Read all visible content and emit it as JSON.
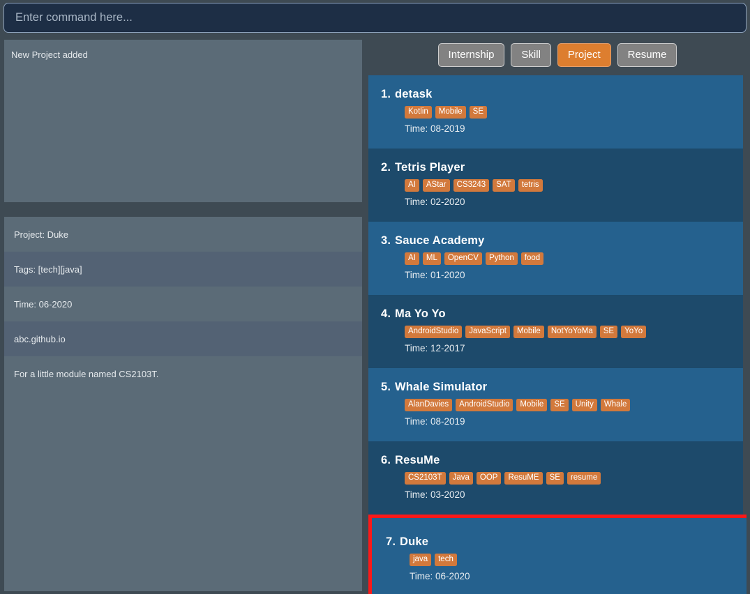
{
  "command": {
    "placeholder": "Enter command here...",
    "value": ""
  },
  "result": {
    "message": "New Project added"
  },
  "detail": {
    "rows": [
      {
        "text": "Project: Duke"
      },
      {
        "text": "Tags: [tech][java]"
      },
      {
        "text": "Time: 06-2020"
      },
      {
        "text": "abc.github.io"
      },
      {
        "text": "For a little module named CS2103T."
      }
    ]
  },
  "tabs": [
    {
      "label": "Internship",
      "active": false
    },
    {
      "label": "Skill",
      "active": false
    },
    {
      "label": "Project",
      "active": true
    },
    {
      "label": "Resume",
      "active": false
    }
  ],
  "colors": {
    "accent": "#DD7E2F",
    "tag": "#D2793C",
    "row_light": "#25618E",
    "row_dark": "#1D4A6B",
    "selection_outline": "#FA1919",
    "panel": "#5B6B77",
    "panel_alt": "#536274",
    "app_background": "#3E4A53",
    "command_background": "#1D2E45"
  },
  "list": {
    "items": [
      {
        "index": "1.",
        "title": "detask",
        "tags": [
          "Kotlin",
          "Mobile",
          "SE"
        ],
        "time": "Time: 08-2019",
        "selected": false
      },
      {
        "index": "2.",
        "title": "Tetris Player",
        "tags": [
          "AI",
          "AStar",
          "CS3243",
          "SAT",
          "tetris"
        ],
        "time": "Time: 02-2020",
        "selected": false
      },
      {
        "index": "3.",
        "title": "Sauce Academy",
        "tags": [
          "AI",
          "ML",
          "OpenCV",
          "Python",
          "food"
        ],
        "time": "Time: 01-2020",
        "selected": false
      },
      {
        "index": "4.",
        "title": "Ma Yo Yo",
        "tags": [
          "AndroidStudio",
          "JavaScript",
          "Mobile",
          "NotYoYoMa",
          "SE",
          "YoYo"
        ],
        "time": "Time: 12-2017",
        "selected": false
      },
      {
        "index": "5.",
        "title": "Whale Simulator",
        "tags": [
          "AlanDavies",
          "AndroidStudio",
          "Mobile",
          "SE",
          "Unity",
          "Whale"
        ],
        "time": "Time: 08-2019",
        "selected": false
      },
      {
        "index": "6.",
        "title": "ResuMe",
        "tags": [
          "CS2103T",
          "Java",
          "OOP",
          "ResuME",
          "SE",
          "resume"
        ],
        "time": "Time: 03-2020",
        "selected": false
      },
      {
        "index": "7.",
        "title": "Duke",
        "tags": [
          "java",
          "tech"
        ],
        "time": "Time: 06-2020",
        "selected": true
      }
    ]
  }
}
